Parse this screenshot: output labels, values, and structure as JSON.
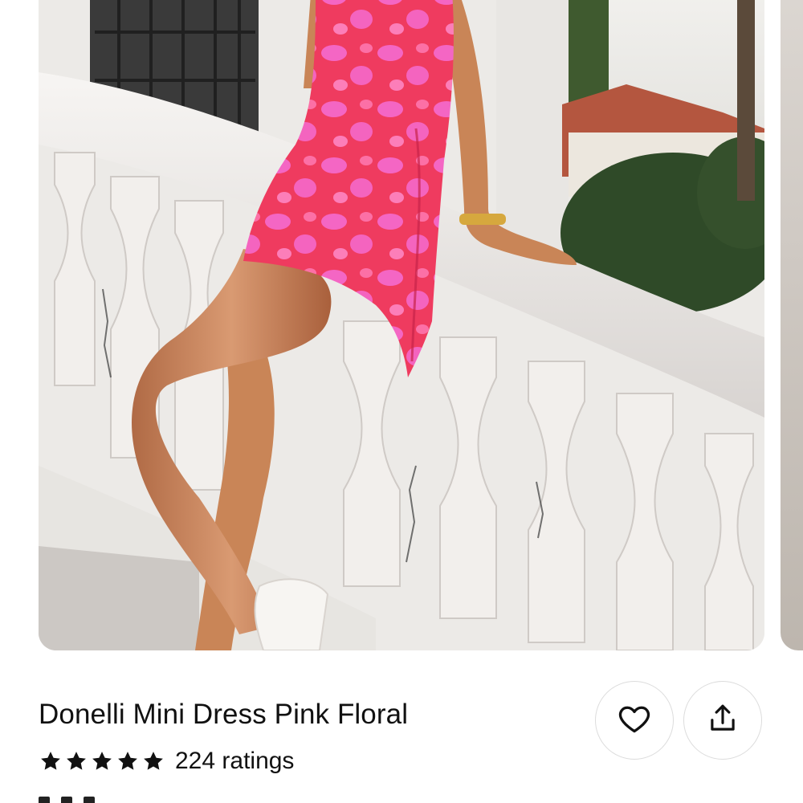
{
  "product": {
    "title": "Donelli Mini Dress Pink Floral",
    "rating_value": 5,
    "rating_max": 5,
    "ratings_count_label": "224 ratings"
  },
  "icons": {
    "favorite": "heart-icon",
    "share": "share-icon",
    "star": "star-icon"
  },
  "colors": {
    "dress_primary": "#ef3b5f",
    "dress_secondary": "#f56bd0",
    "text": "#111111",
    "button_border": "#dcdcdc"
  }
}
